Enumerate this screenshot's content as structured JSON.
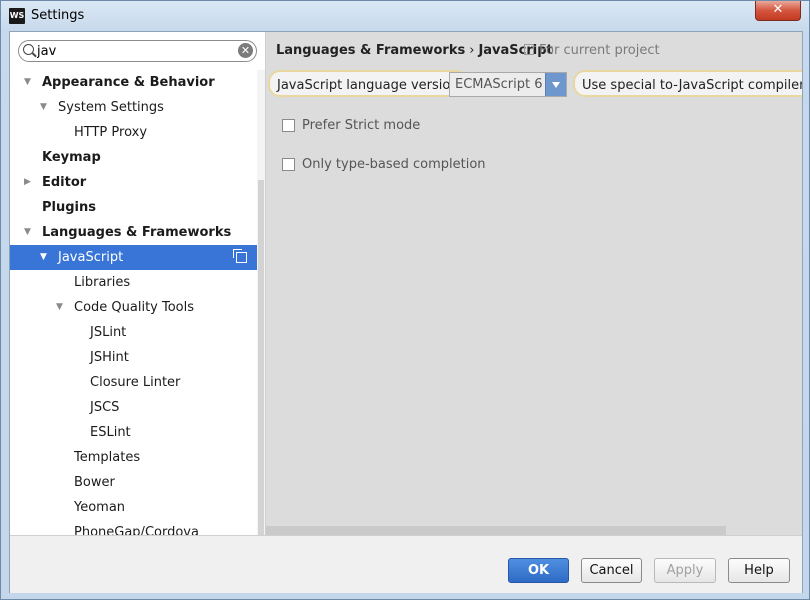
{
  "window": {
    "title": "Settings",
    "app_icon": "WS"
  },
  "search": {
    "value": "jav"
  },
  "tree": [
    {
      "label": "Appearance & Behavior",
      "depth": 0,
      "arrow": "▼",
      "bold": true
    },
    {
      "label": "System Settings",
      "depth": 1,
      "arrow": "▼",
      "bold": false
    },
    {
      "label": "HTTP Proxy",
      "depth": 2,
      "arrow": "",
      "bold": false
    },
    {
      "label": "Keymap",
      "depth": 0,
      "arrow": "",
      "bold": true
    },
    {
      "label": "Editor",
      "depth": 0,
      "arrow": "▶",
      "bold": true
    },
    {
      "label": "Plugins",
      "depth": 0,
      "arrow": "",
      "bold": true
    },
    {
      "label": "Languages & Frameworks",
      "depth": 0,
      "arrow": "▼",
      "bold": true
    },
    {
      "label": "JavaScript",
      "depth": 1,
      "arrow": "▼",
      "bold": false,
      "selected": true
    },
    {
      "label": "Libraries",
      "depth": 2,
      "arrow": "",
      "bold": false
    },
    {
      "label": "Code Quality Tools",
      "depth": 2,
      "arrow": "▼",
      "bold": false
    },
    {
      "label": "JSLint",
      "depth": 3,
      "arrow": "",
      "bold": false
    },
    {
      "label": "JSHint",
      "depth": 3,
      "arrow": "",
      "bold": false
    },
    {
      "label": "Closure Linter",
      "depth": 3,
      "arrow": "",
      "bold": false
    },
    {
      "label": "JSCS",
      "depth": 3,
      "arrow": "",
      "bold": false
    },
    {
      "label": "ESLint",
      "depth": 3,
      "arrow": "",
      "bold": false
    },
    {
      "label": "Templates",
      "depth": 2,
      "arrow": "",
      "bold": false
    },
    {
      "label": "Bower",
      "depth": 2,
      "arrow": "",
      "bold": false
    },
    {
      "label": "Yeoman",
      "depth": 2,
      "arrow": "",
      "bold": false
    },
    {
      "label": "PhoneGap/Cordova",
      "depth": 2,
      "arrow": "",
      "bold": false
    }
  ],
  "breadcrumb": {
    "parent": "Languages & Frameworks",
    "separator": "›",
    "current": "JavaScript"
  },
  "for_project": "For current project",
  "js_settings": {
    "version_label": "JavaScript language version",
    "version_value": "ECMAScript 6",
    "compiler_label": "Use special to-JavaScript compiler with",
    "strict_mode": "Prefer Strict mode",
    "type_completion": "Only type-based completion"
  },
  "buttons": {
    "ok": "OK",
    "cancel": "Cancel",
    "apply": "Apply",
    "help": "Help"
  },
  "colors": {
    "selection": "#3875d7",
    "ok_button": "#2f6bc6"
  }
}
